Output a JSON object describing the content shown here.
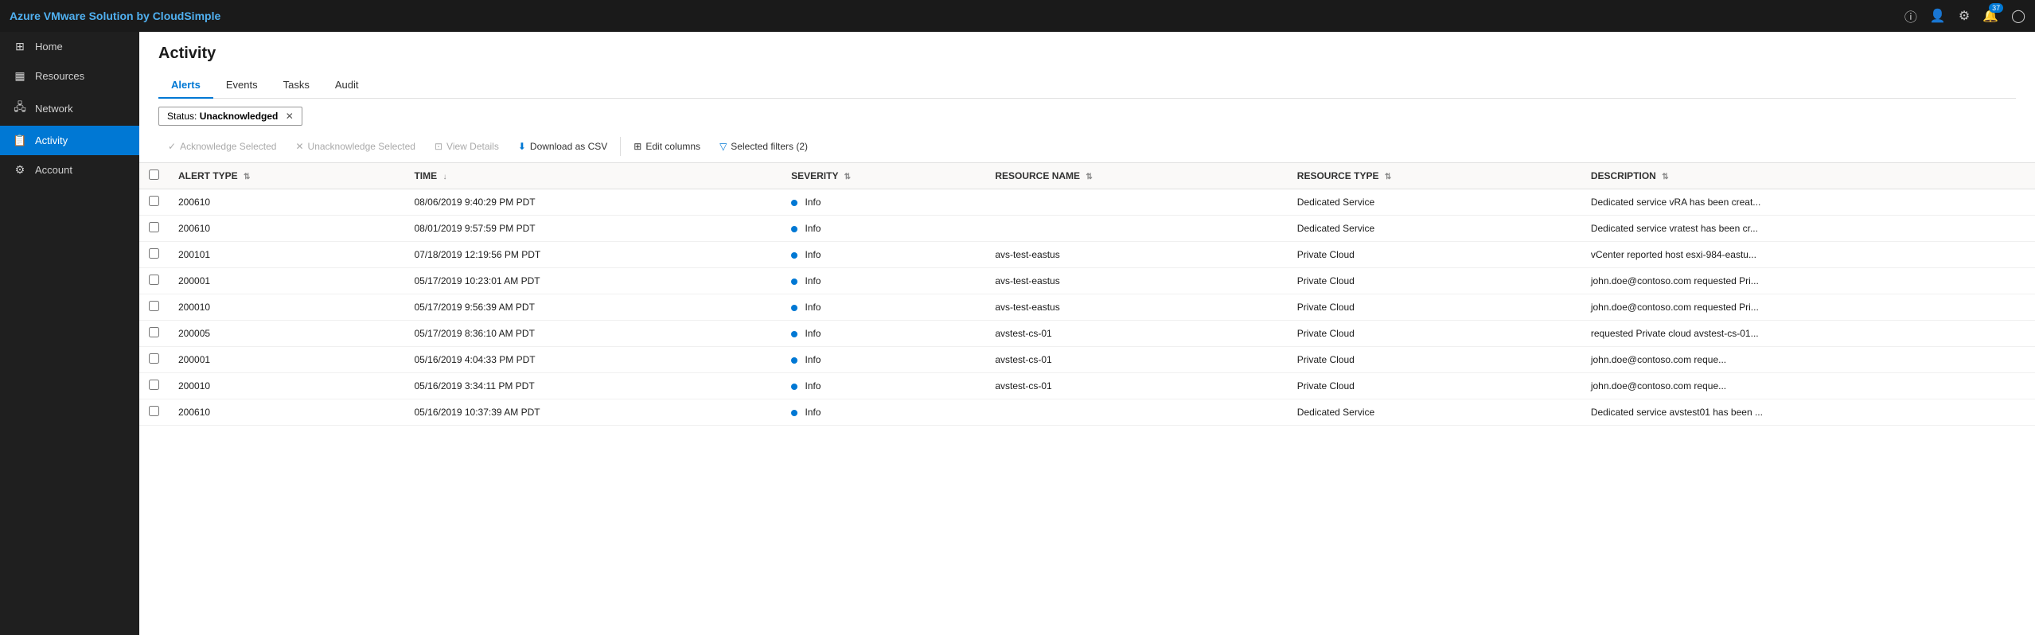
{
  "app": {
    "title": "Azure VMware Solution by CloudSimple"
  },
  "topbar": {
    "title": "Azure VMware Solution by CloudSimple",
    "notification_count": "37"
  },
  "sidebar": {
    "items": [
      {
        "id": "home",
        "label": "Home",
        "icon": "⊞"
      },
      {
        "id": "resources",
        "label": "Resources",
        "icon": "⊟"
      },
      {
        "id": "network",
        "label": "Network",
        "icon": "🖥"
      },
      {
        "id": "activity",
        "label": "Activity",
        "icon": "📋",
        "active": true
      },
      {
        "id": "account",
        "label": "Account",
        "icon": "⚙"
      }
    ]
  },
  "page": {
    "title": "Activity"
  },
  "tabs": [
    {
      "id": "alerts",
      "label": "Alerts",
      "active": true
    },
    {
      "id": "events",
      "label": "Events",
      "active": false
    },
    {
      "id": "tasks",
      "label": "Tasks",
      "active": false
    },
    {
      "id": "audit",
      "label": "Audit",
      "active": false
    }
  ],
  "filter": {
    "status_label": "Status:",
    "status_value": "Unacknowledged"
  },
  "toolbar": {
    "acknowledge": "Acknowledge Selected",
    "unacknowledge": "Unacknowledge Selected",
    "view_details": "View Details",
    "download_csv": "Download as CSV",
    "edit_columns": "Edit columns",
    "selected_filters": "Selected filters (2)"
  },
  "table": {
    "columns": [
      {
        "id": "alert_type",
        "label": "ALERT TYPE"
      },
      {
        "id": "time",
        "label": "TIME"
      },
      {
        "id": "severity",
        "label": "SEVERITY"
      },
      {
        "id": "resource_name",
        "label": "RESOURCE NAME"
      },
      {
        "id": "resource_type",
        "label": "RESOURCE TYPE"
      },
      {
        "id": "description",
        "label": "DESCRIPTION"
      }
    ],
    "rows": [
      {
        "alert_type": "200610",
        "time": "08/06/2019 9:40:29 PM PDT",
        "severity": "Info",
        "resource_name": "",
        "resource_type": "Dedicated Service",
        "description": "Dedicated service vRA has been creat..."
      },
      {
        "alert_type": "200610",
        "time": "08/01/2019 9:57:59 PM PDT",
        "severity": "Info",
        "resource_name": "",
        "resource_type": "Dedicated Service",
        "description": "Dedicated service vratest has been cr..."
      },
      {
        "alert_type": "200101",
        "time": "07/18/2019 12:19:56 PM PDT",
        "severity": "Info",
        "resource_name": "avs-test-eastus",
        "resource_type": "Private Cloud",
        "description": "vCenter reported host esxi-984-eastu..."
      },
      {
        "alert_type": "200001",
        "time": "05/17/2019 10:23:01 AM PDT",
        "severity": "Info",
        "resource_name": "avs-test-eastus",
        "resource_type": "Private Cloud",
        "description": "john.doe@contoso.com  requested Pri..."
      },
      {
        "alert_type": "200010",
        "time": "05/17/2019 9:56:39 AM PDT",
        "severity": "Info",
        "resource_name": "avs-test-eastus",
        "resource_type": "Private Cloud",
        "description": "john.doe@contoso.com  requested Pri..."
      },
      {
        "alert_type": "200005",
        "time": "05/17/2019 8:36:10 AM PDT",
        "severity": "Info",
        "resource_name": "avstest-cs-01",
        "resource_type": "Private Cloud",
        "description": "requested Private cloud avstest-cs-01..."
      },
      {
        "alert_type": "200001",
        "time": "05/16/2019 4:04:33 PM PDT",
        "severity": "Info",
        "resource_name": "avstest-cs-01",
        "resource_type": "Private Cloud",
        "description": "john.doe@contoso.com   reque..."
      },
      {
        "alert_type": "200010",
        "time": "05/16/2019 3:34:11 PM PDT",
        "severity": "Info",
        "resource_name": "avstest-cs-01",
        "resource_type": "Private Cloud",
        "description": "john.doe@contoso.com   reque..."
      },
      {
        "alert_type": "200610",
        "time": "05/16/2019 10:37:39 AM PDT",
        "severity": "Info",
        "resource_name": "",
        "resource_type": "Dedicated Service",
        "description": "Dedicated service avstest01 has been ..."
      }
    ]
  }
}
